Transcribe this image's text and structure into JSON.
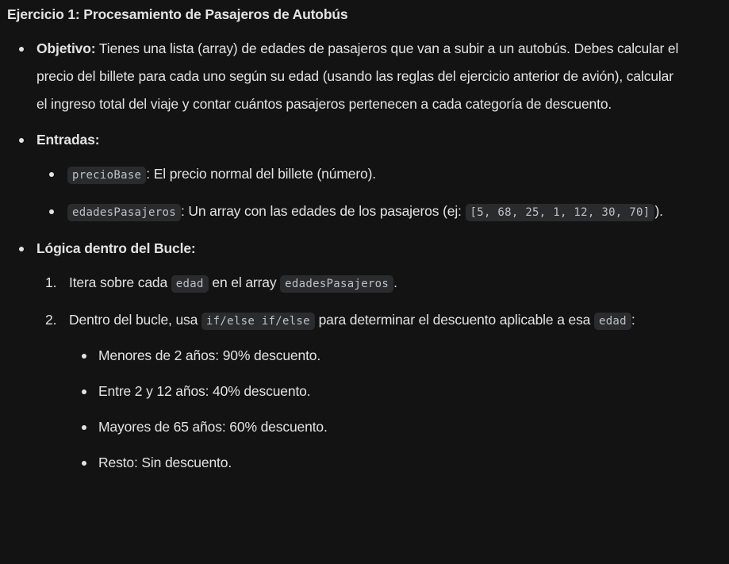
{
  "title": "Ejercicio 1: Procesamiento de Pasajeros de Autobús",
  "objetivo": {
    "label": "Objetivo:",
    "text": "Tienes una lista (array) de edades de pasajeros que van a subir a un autobús. Debes calcular el precio del billete para cada uno según su edad (usando las reglas del ejercicio anterior de avión), calcular el ingreso total del viaje y contar cuántos pasajeros pertenecen a cada categoría de descuento."
  },
  "entradas": {
    "label": "Entradas:",
    "items": [
      {
        "code": "precioBase",
        "text": ": El precio normal del billete (número)."
      },
      {
        "code": "edadesPasajeros",
        "text": ": Un array con las edades de los pasajeros (ej: ",
        "code2": "[5, 68, 25, 1, 12, 30, 70]",
        "text2": ")."
      }
    ]
  },
  "logica": {
    "label": "Lógica dentro del Bucle:",
    "steps": [
      {
        "num": "1.",
        "t1": "Itera sobre cada ",
        "c1": "edad",
        "t2": " en el array ",
        "c2": "edadesPasajeros",
        "t3": "."
      },
      {
        "num": "2.",
        "t1": "Dentro del bucle, usa ",
        "c1": "if/else if/else",
        "t2": " para determinar el descuento aplicable a esa ",
        "c2": "edad",
        "t3": ":"
      }
    ],
    "rules": [
      "Menores de 2 años: 90% descuento.",
      "Entre 2 y 12 años: 40% descuento.",
      "Mayores de 65 años: 60% descuento.",
      "Resto: Sin descuento."
    ]
  }
}
